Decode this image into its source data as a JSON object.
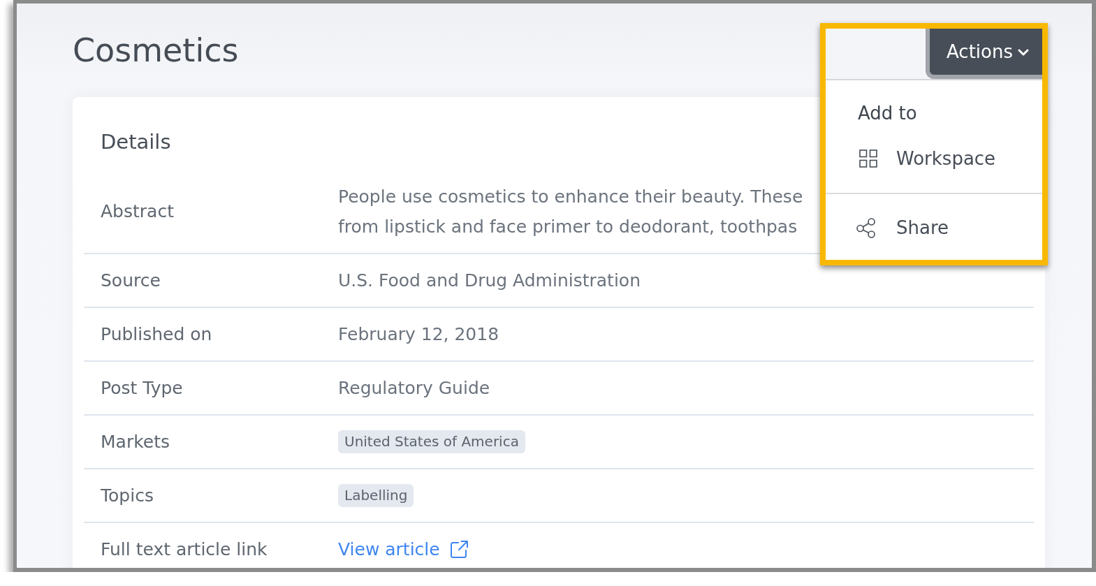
{
  "page": {
    "title": "Cosmetics"
  },
  "actions": {
    "label": "Actions",
    "expanded": true,
    "highlighted": true,
    "menu": [
      {
        "heading": "Add to",
        "items": [
          {
            "label": "Workspace"
          }
        ]
      },
      {
        "items": [
          {
            "label": "Share"
          }
        ]
      }
    ]
  },
  "details": {
    "heading": "Details",
    "rows": [
      {
        "label": "Abstract",
        "kind": "paragraph",
        "lines": [
          "People use cosmetics to enhance their beauty. These",
          "from lipstick and face primer to deodorant, toothpas"
        ]
      },
      {
        "label": "Source",
        "kind": "text",
        "value": "U.S. Food and Drug Administration"
      },
      {
        "label": "Published on",
        "kind": "text",
        "value": "February 12, 2018"
      },
      {
        "label": "Post Type",
        "kind": "text",
        "value": "Regulatory Guide"
      },
      {
        "label": "Markets",
        "kind": "tags",
        "tags": [
          "United States of America"
        ]
      },
      {
        "label": "Topics",
        "kind": "tags",
        "tags": [
          "Labelling"
        ]
      },
      {
        "label": "Full text article link",
        "kind": "link",
        "value": "View article"
      }
    ]
  }
}
